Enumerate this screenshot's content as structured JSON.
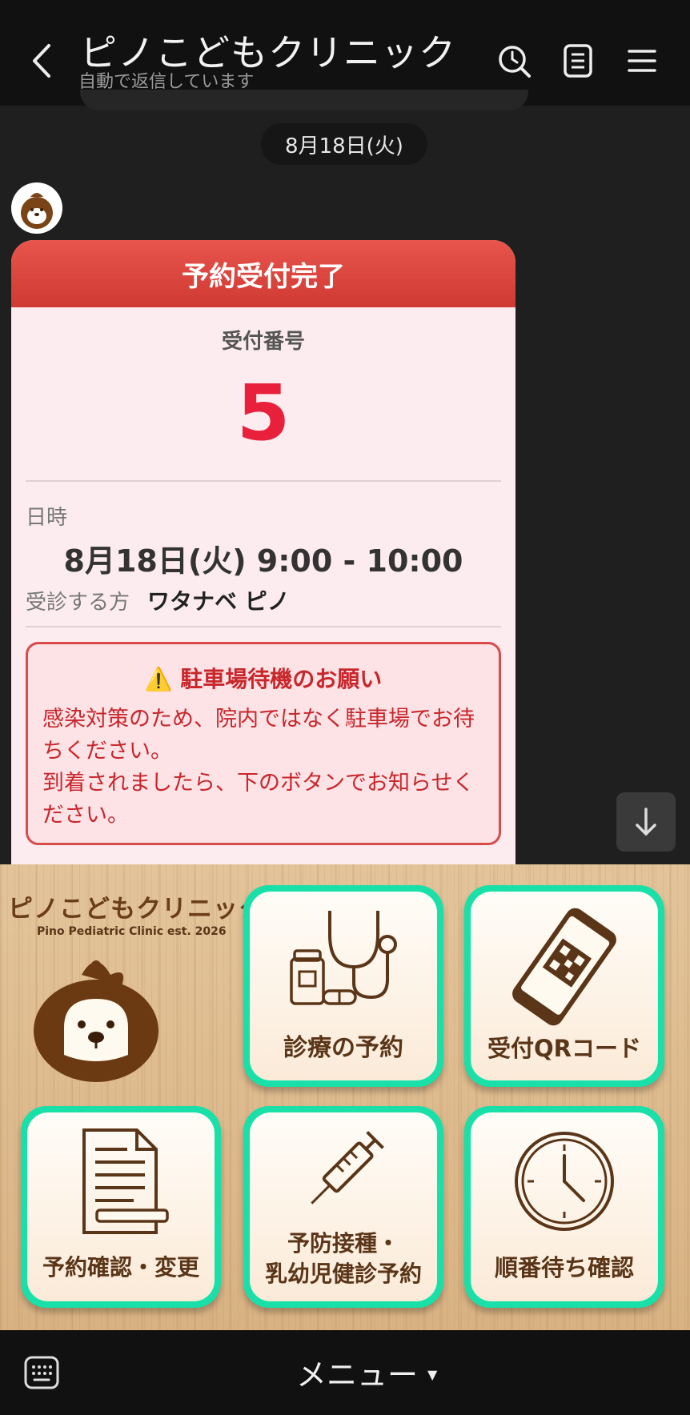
{
  "header": {
    "title": "ピノこどもクリニック",
    "subtitle": "自動で返信しています"
  },
  "chat": {
    "date": "8月18日(火)",
    "card": {
      "title": "予約受付完了",
      "receipt_label": "受付番号",
      "receipt_number": "5",
      "datetime_label": "日時",
      "datetime_value": "8月18日(火) 9:00 - 10:00",
      "patient_label": "受診する方",
      "patient_name": "ワタナベ ピノ",
      "notice": {
        "icon": "⚠️",
        "title": "駐車場待機のお願い",
        "line1": "感染対策のため、院内ではなく駐車場でお待ちください。",
        "line2": "到着されましたら、下のボタンでお知らせください。"
      }
    }
  },
  "rich_menu": {
    "logo_text": "ピノこどもクリニック",
    "logo_sub": "Pino Pediatric Clinic est. 2026",
    "tiles": [
      {
        "label": "診療の予約",
        "icon": "stethoscope-icon"
      },
      {
        "label": "受付QRコード",
        "icon": "qr-phone-icon"
      },
      {
        "label": "予約確認・変更",
        "icon": "document-icon"
      },
      {
        "label_line1": "予防接種・",
        "label_line2": "乳幼児健診予約",
        "icon": "syringe-icon"
      },
      {
        "label": "順番待ち確認",
        "icon": "clock-icon"
      }
    ],
    "colors": {
      "tile_border": "#18e0a8",
      "brown": "#5a3518"
    }
  },
  "bottom_bar": {
    "menu_label": "メニュー",
    "caret": "▼"
  }
}
